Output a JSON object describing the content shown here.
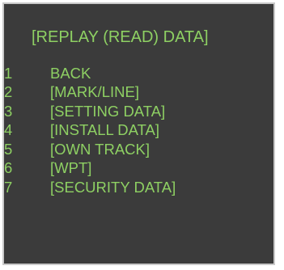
{
  "menu": {
    "title": "[REPLAY (READ) DATA]",
    "items": [
      {
        "number": "1",
        "label": "BACK"
      },
      {
        "number": "2",
        "label": "[MARK/LINE]"
      },
      {
        "number": "3",
        "label": "[SETTING DATA]"
      },
      {
        "number": "4",
        "label": "[INSTALL DATA]"
      },
      {
        "number": "5",
        "label": "[OWN TRACK]"
      },
      {
        "number": "6",
        "label": "[WPT]"
      },
      {
        "number": "7",
        "label": "[SECURITY DATA]"
      }
    ]
  },
  "colors": {
    "background": "#3b3b3b",
    "text": "#8ed063",
    "border": "#c9c9c9"
  }
}
